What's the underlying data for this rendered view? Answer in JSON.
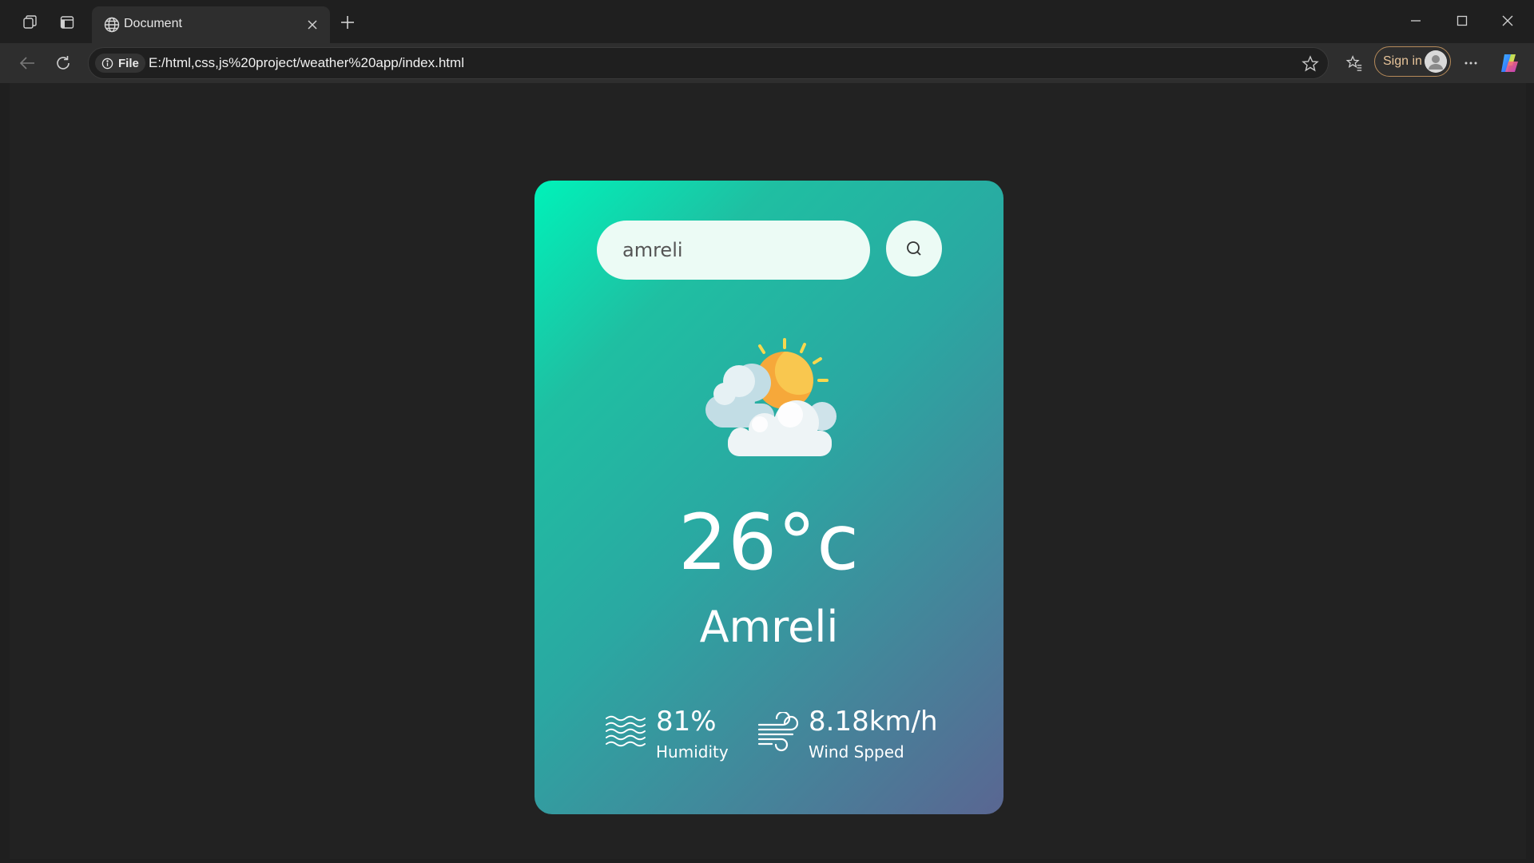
{
  "browser": {
    "tab": {
      "title": "Document"
    },
    "address_bar": {
      "scheme_label": "File",
      "url": "E:/html,css,js%20project/weather%20app/index.html"
    },
    "sign_in_label": "Sign in"
  },
  "weather_app": {
    "search": {
      "value": "amreli"
    },
    "condition_icon": "partly-cloudy-sun-icon",
    "temperature": "26°c",
    "city": "Amreli",
    "humidity": {
      "value": "81%",
      "label": "Humidity",
      "icon": "humidity-waves-icon"
    },
    "wind": {
      "value": "8.18km/h",
      "label": "Wind Spped",
      "icon": "wind-icon"
    }
  },
  "colors": {
    "card_gradient_start": "#00f2b9",
    "card_gradient_end": "#5a6692",
    "input_background": "#ecfbf5",
    "page_background": "#222222"
  }
}
